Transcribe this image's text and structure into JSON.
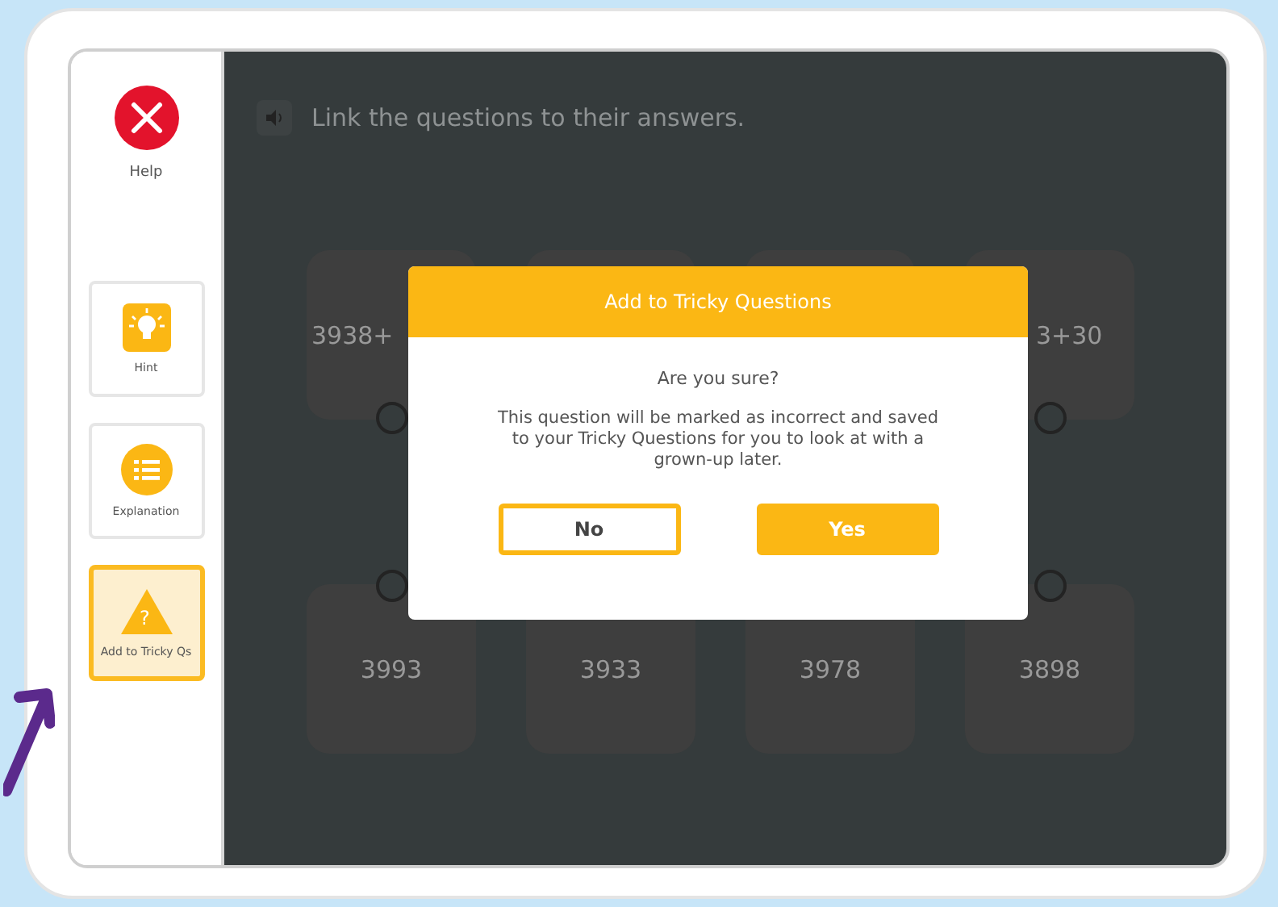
{
  "sidebar": {
    "help": {
      "label": "Help"
    },
    "tools": [
      {
        "kind": "hint",
        "label": "Hint",
        "selected": false
      },
      {
        "kind": "explanation",
        "label": "Explanation",
        "selected": false
      },
      {
        "kind": "tricky",
        "label": "Add to Tricky Qs",
        "selected": true,
        "icon": "?"
      }
    ]
  },
  "question": {
    "instruction": "Link the questions to their answers."
  },
  "questions": [
    {
      "kind": "shown",
      "text": "3938+"
    },
    {
      "kind": "covered"
    },
    {
      "kind": "covered"
    },
    {
      "kind": "shown",
      "text": "3+30"
    }
  ],
  "answers": [
    {
      "text": "3993"
    },
    {
      "text": "3933"
    },
    {
      "text": "3978"
    },
    {
      "text": "3898"
    }
  ],
  "dialog": {
    "title": "Add to Tricky Questions",
    "heading": "Are you sure?",
    "message": "This question will be marked as incorrect and saved to your Tricky Questions for you to look at with a grown-up later.",
    "buttons": [
      {
        "kind": "secondary",
        "label": "No"
      },
      {
        "kind": "primary",
        "label": "Yes"
      }
    ]
  }
}
